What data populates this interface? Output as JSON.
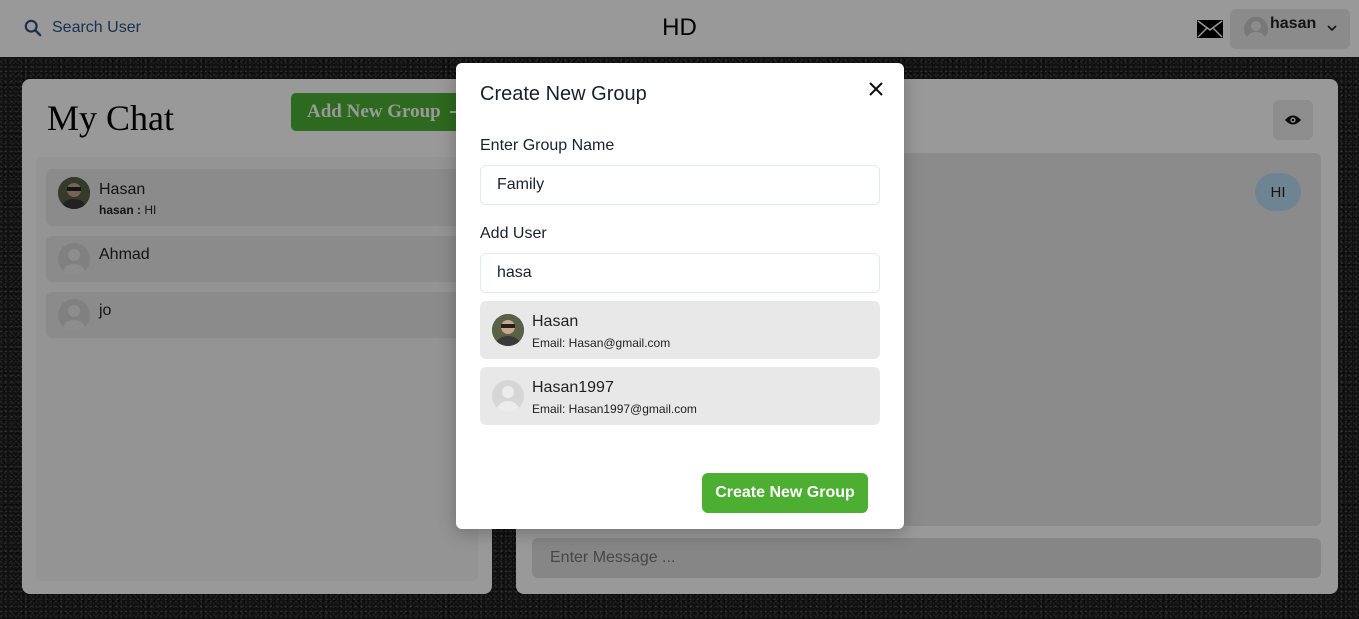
{
  "topbar": {
    "search_label": "Search User",
    "app_title": "HD",
    "user_name": "hasan"
  },
  "left_panel": {
    "title": "My Chat",
    "add_group_label": "Add New Group",
    "chats": [
      {
        "name": "Hasan",
        "last_sender": "hasan :",
        "last_message": "HI",
        "avatar": "photo"
      },
      {
        "name": "Ahmad",
        "avatar": "default"
      },
      {
        "name": "jo",
        "avatar": "default"
      }
    ]
  },
  "right_panel": {
    "message_bubble": "HI",
    "message_placeholder": "Enter Message ..."
  },
  "modal": {
    "title": "Create New Group",
    "group_name_label": "Enter Group Name",
    "group_name_value": "Family",
    "add_user_label": "Add User",
    "add_user_value": "hasa",
    "results": [
      {
        "name": "Hasan",
        "email": "Email: Hasan@gmail.com",
        "avatar": "photo"
      },
      {
        "name": "Hasan1997",
        "email": "Email: Hasan1997@gmail.com",
        "avatar": "default"
      }
    ],
    "submit_label": "Create New Group"
  },
  "colors": {
    "accent_green": "#4caf32",
    "search_blue": "#2c5282",
    "bubble_blue": "#b9dcf5"
  }
}
